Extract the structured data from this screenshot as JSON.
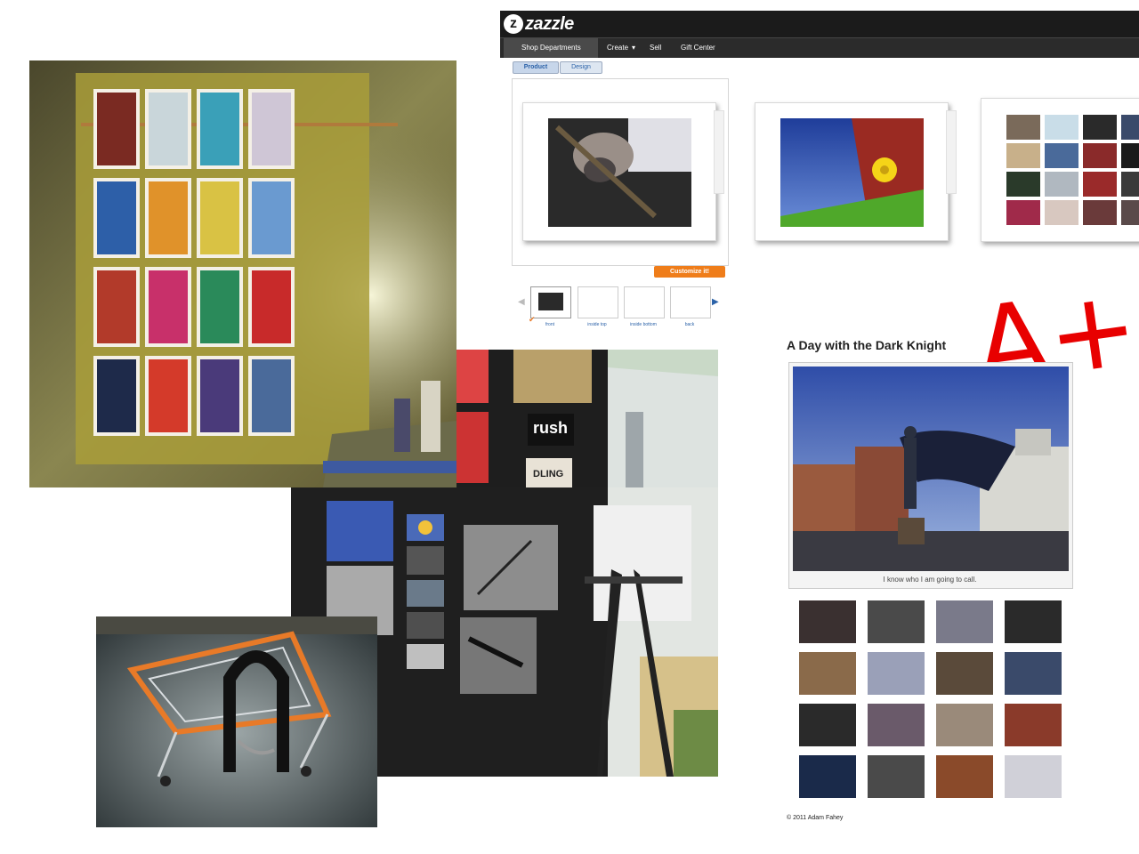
{
  "zazzle": {
    "logo_mark": "z",
    "logo_text": "zazzle",
    "nav": {
      "shop": "Shop Departments",
      "create": "Create",
      "sell": "Sell",
      "gift": "Gift Center"
    },
    "tabs": {
      "product": "Product",
      "design": "Design"
    },
    "customize_label": "Customize it!",
    "preview_labels": [
      "front",
      "inside top",
      "inside bottom",
      "back"
    ],
    "check_mark": "✔"
  },
  "dark_knight": {
    "title": "A Day with the Dark Knight",
    "caption": "I know who I am going to call.",
    "copyright": "© 2011 Adam Fahey"
  },
  "annotation": {
    "grade": "A+"
  },
  "board_text": {
    "rush": "rush",
    "dling": "DLING"
  },
  "colors": {
    "zazzle_header": "#1b1b1b",
    "customize_orange": "#ef7d1a",
    "grade_red": "#e80000",
    "link_blue": "#2b62a8"
  }
}
